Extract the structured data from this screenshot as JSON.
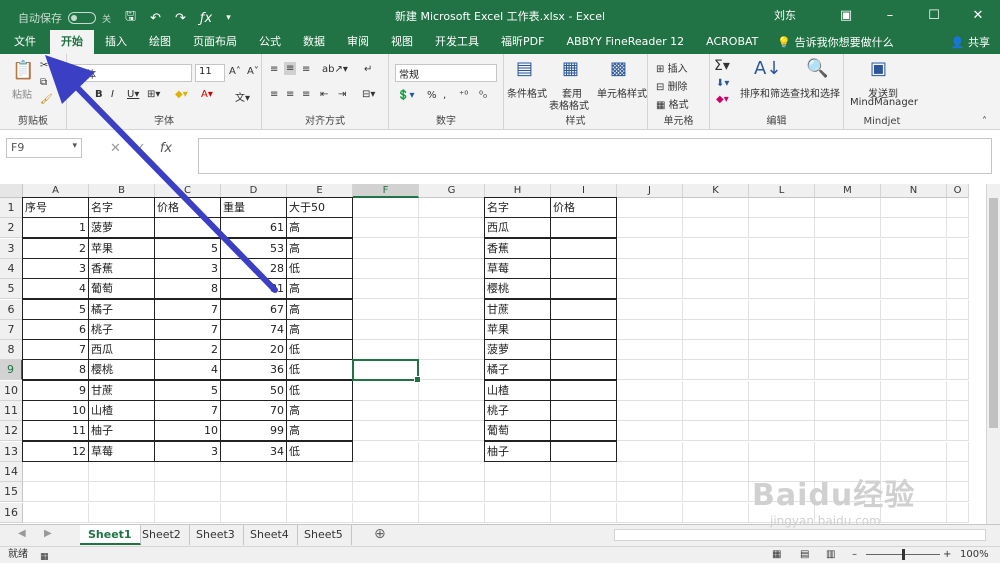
{
  "titlebar": {
    "autosave_label": "自动保存",
    "autosave_state": "关",
    "title": "新建 Microsoft Excel 工作表.xlsx  -  Excel",
    "user": "刘东"
  },
  "tabs": [
    "文件",
    "开始",
    "插入",
    "绘图",
    "页面布局",
    "公式",
    "数据",
    "审阅",
    "视图",
    "开发工具",
    "福昕PDF",
    "ABBYY FineReader 12",
    "ACROBAT"
  ],
  "active_tab": 1,
  "tellme": "告诉我你想要做什么",
  "share": "共享",
  "ribbon": {
    "clipboard": {
      "paste": "粘贴",
      "group": "剪贴板"
    },
    "font": {
      "name": "宋体",
      "size": "11",
      "group": "字体"
    },
    "align": {
      "group": "对齐方式"
    },
    "number": {
      "format": "常规",
      "group": "数字"
    },
    "styles": {
      "cond": "条件格式",
      "table1": "套用",
      "table2": "表格格式",
      "cellstyle": "单元格样式",
      "group": "样式"
    },
    "cells": {
      "insert": "插入",
      "delete": "删除",
      "format": "格式",
      "group": "单元格"
    },
    "edit": {
      "sort": "排序和筛选",
      "find": "查找和选择",
      "group": "编辑"
    },
    "mindjet": {
      "send1": "发送到",
      "send2": "MindManager",
      "group": "Mindjet"
    }
  },
  "namebox": "F9",
  "columns": [
    "A",
    "B",
    "C",
    "D",
    "E",
    "F",
    "G",
    "H",
    "I",
    "J",
    "K",
    "L",
    "M",
    "N",
    "O"
  ],
  "selected_column": "F",
  "rows": [
    "1",
    "2",
    "3",
    "4",
    "5",
    "6",
    "7",
    "8",
    "9",
    "10",
    "11",
    "12",
    "13",
    "14",
    "15",
    "16"
  ],
  "selected_row": "9",
  "table1": {
    "headers": [
      "序号",
      "名字",
      "价格",
      "重量",
      "大于50"
    ],
    "rows": [
      [
        "1",
        "菠萝",
        "",
        "61",
        "高"
      ],
      [
        "2",
        "苹果",
        "5",
        "53",
        "高"
      ],
      [
        "3",
        "香蕉",
        "3",
        "28",
        "低"
      ],
      [
        "4",
        "葡萄",
        "8",
        "81",
        "高"
      ],
      [
        "5",
        "橘子",
        "7",
        "67",
        "高"
      ],
      [
        "6",
        "桃子",
        "7",
        "74",
        "高"
      ],
      [
        "7",
        "西瓜",
        "2",
        "20",
        "低"
      ],
      [
        "8",
        "樱桃",
        "4",
        "36",
        "低"
      ],
      [
        "9",
        "甘蔗",
        "5",
        "50",
        "低"
      ],
      [
        "10",
        "山楂",
        "7",
        "70",
        "高"
      ],
      [
        "11",
        "柚子",
        "10",
        "99",
        "高"
      ],
      [
        "12",
        "草莓",
        "3",
        "34",
        "低"
      ]
    ]
  },
  "table2": {
    "headers": [
      "名字",
      "价格"
    ],
    "rows": [
      [
        "西瓜",
        ""
      ],
      [
        "香蕉",
        ""
      ],
      [
        "草莓",
        ""
      ],
      [
        "樱桃",
        ""
      ],
      [
        "甘蔗",
        ""
      ],
      [
        "苹果",
        ""
      ],
      [
        "菠萝",
        ""
      ],
      [
        "橘子",
        ""
      ],
      [
        "山楂",
        ""
      ],
      [
        "桃子",
        ""
      ],
      [
        "葡萄",
        ""
      ],
      [
        "柚子",
        ""
      ]
    ]
  },
  "sheets": [
    "Sheet1",
    "Sheet2",
    "Sheet3",
    "Sheet4",
    "Sheet5"
  ],
  "active_sheet": "Sheet1",
  "status": {
    "ready": "就绪",
    "zoom": "100%"
  },
  "watermark": "Baidu经验",
  "watermark_url": "jingyan.baidu.com",
  "colors": {
    "excel_green": "#217346",
    "arrow": "#3a3fc4"
  }
}
